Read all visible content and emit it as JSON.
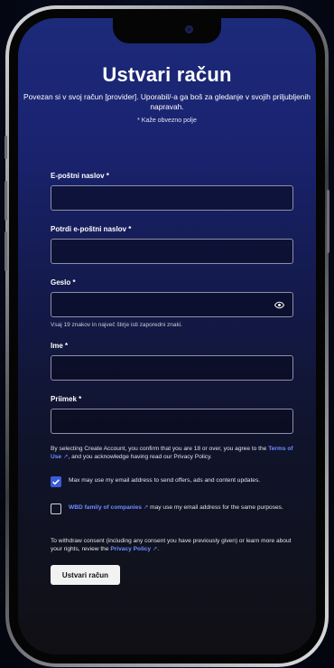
{
  "header": {
    "title": "Ustvari račun",
    "subtitle": "Povezan si v svoj račun [provider]. Uporabil/-a ga boš za gledanje v svojih priljubljenih napravah.",
    "required_note": "* Kaže obvezno polje"
  },
  "form": {
    "email_label": "E-poštni naslov *",
    "email_value": "",
    "confirm_email_label": "Potrdi e-poštni naslov *",
    "confirm_email_value": "",
    "password_label": "Geslo *",
    "password_value": "",
    "password_hint": "Vsaj 19 znakov in največ štirje isti zaporedni znaki.",
    "first_name_label": "Ime *",
    "first_name_value": "",
    "last_name_label": "Priimek *",
    "last_name_value": ""
  },
  "legal": {
    "terms_prefix": "By selecting Create Account, you confirm that you are 18 or over, you agree to the",
    "terms_link": "Terms of Use",
    "terms_suffix": ", and you acknowledge having read our Privacy Policy.",
    "marketing_label": "Max may use my email address to send offers, ads and content updates.",
    "marketing_checked": true,
    "wbd_link": "WBD family of companies",
    "wbd_label": "may use my email address for the same purposes.",
    "wbd_checked": false,
    "withdraw_text": "To withdraw consent (including any consent you have previously given) or learn more about your rights, review the",
    "privacy_link": "Privacy Policy"
  },
  "submit_label": "Ustvari račun",
  "icons": {
    "password_toggle": "eye-icon",
    "external_link": "external-link-icon",
    "checkmark": "checkmark-icon"
  },
  "colors": {
    "accent": "#3b5bdb",
    "link": "#6f8cff",
    "header_gradient_top": "#1c2a7a"
  }
}
